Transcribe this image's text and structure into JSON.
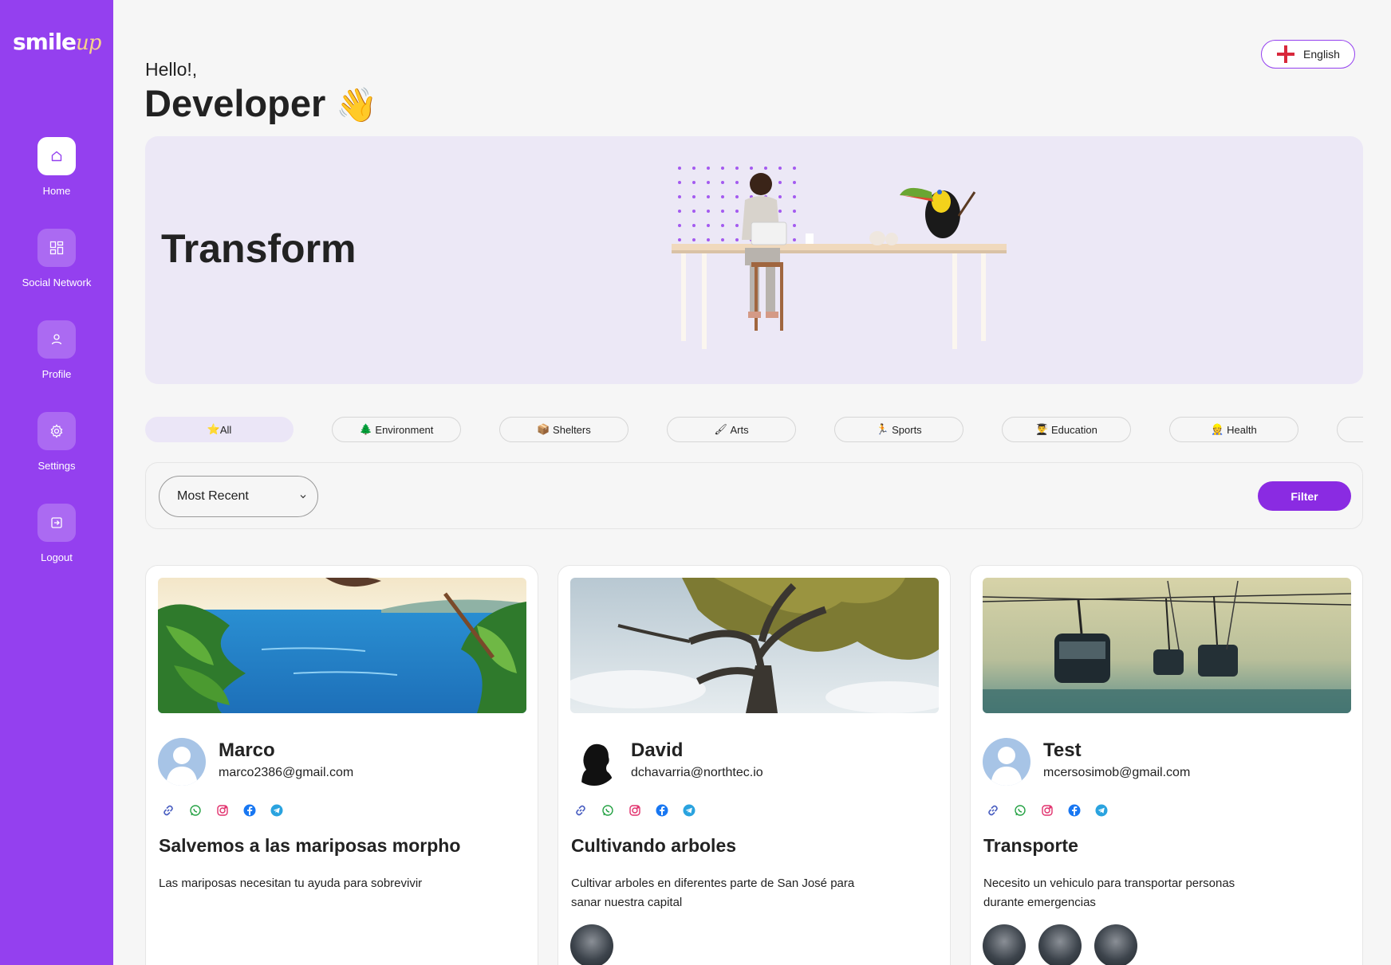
{
  "app": {
    "logo_main": "smile",
    "logo_accent": "up"
  },
  "sidebar": {
    "items": [
      {
        "label": "Home",
        "icon": "home-icon",
        "active": true
      },
      {
        "label": "Social Network",
        "icon": "grid-icon",
        "active": false
      },
      {
        "label": "Profile",
        "icon": "user-icon",
        "active": false
      },
      {
        "label": "Settings",
        "icon": "gear-icon",
        "active": false
      },
      {
        "label": "Logout",
        "icon": "logout-icon",
        "active": false
      }
    ]
  },
  "header": {
    "greeting": "Hello!,",
    "user_name": "Developer",
    "wave_emoji": "👋"
  },
  "language": {
    "label": "English",
    "icon": "england-flag-icon"
  },
  "banner": {
    "title": "Transform"
  },
  "categories": [
    {
      "emoji": "⭐",
      "label": "All",
      "active": true
    },
    {
      "emoji": "🌲",
      "label": "Environment",
      "active": false
    },
    {
      "emoji": "📦",
      "label": "Shelters",
      "active": false
    },
    {
      "emoji": "🖌",
      "label": "Arts",
      "active": false
    },
    {
      "emoji": "🏃",
      "label": "Sports",
      "active": false
    },
    {
      "emoji": "👨‍🎓",
      "label": "Education",
      "active": false
    },
    {
      "emoji": "👷",
      "label": "Health",
      "active": false
    }
  ],
  "filter": {
    "sort_value": "Most Recent",
    "button_label": "Filter"
  },
  "cards": [
    {
      "name": "Marco",
      "email": "marco2386@gmail.com",
      "title": "Salvemos a las mariposas morpho",
      "description": "Las mariposas necesitan tu ayuda para sobrevivir",
      "participants": 0
    },
    {
      "name": "David",
      "email": "dchavarria@northtec.io",
      "title": "Cultivando arboles",
      "description": "Cultivar arboles en diferentes parte de San José para sanar nuestra capital",
      "participants": 1
    },
    {
      "name": "Test",
      "email": "mcersosimob@gmail.com",
      "title": "Transporte",
      "description": "Necesito un vehiculo para transportar personas durante emergencias",
      "participants": 3
    }
  ],
  "colors": {
    "primary": "#9440ef",
    "button": "#8a2be2",
    "banner_bg": "#ece8f6",
    "page_bg": "#f6f6f6"
  },
  "social_icons": [
    "link-icon",
    "whatsapp-icon",
    "instagram-icon",
    "facebook-icon",
    "telegram-icon"
  ]
}
